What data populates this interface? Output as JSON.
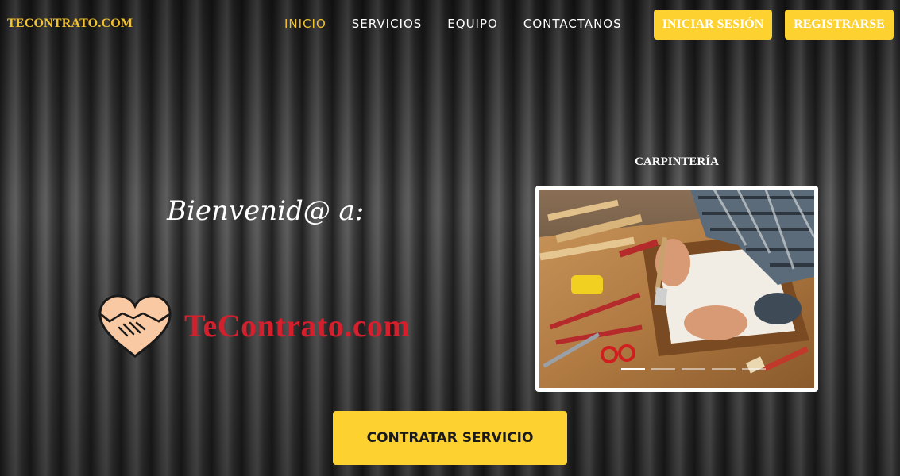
{
  "nav": {
    "brand": "TECONTRATO.COM",
    "links": [
      {
        "label": "INICIO",
        "active": true
      },
      {
        "label": "SERVICIOS",
        "active": false
      },
      {
        "label": "EQUIPO",
        "active": false
      },
      {
        "label": "CONTACTANOS",
        "active": false
      }
    ],
    "login_label": "INICIAR SESIÓN",
    "register_label": "REGISTRARSE"
  },
  "hero": {
    "welcome": "Bienvenid@ a:",
    "logo_text": "TeContrato.com",
    "logo_icon": "handshake-heart-icon"
  },
  "carousel": {
    "title": "CARPINTERÍA",
    "image": "carpentry-tools-photo",
    "slide_count": 5,
    "active_index": 0
  },
  "cta": {
    "label": "CONTRATAR SERVICIO"
  },
  "colors": {
    "accent": "#fdd130",
    "brand": "#f1c232",
    "logo_red": "#d3202c"
  }
}
